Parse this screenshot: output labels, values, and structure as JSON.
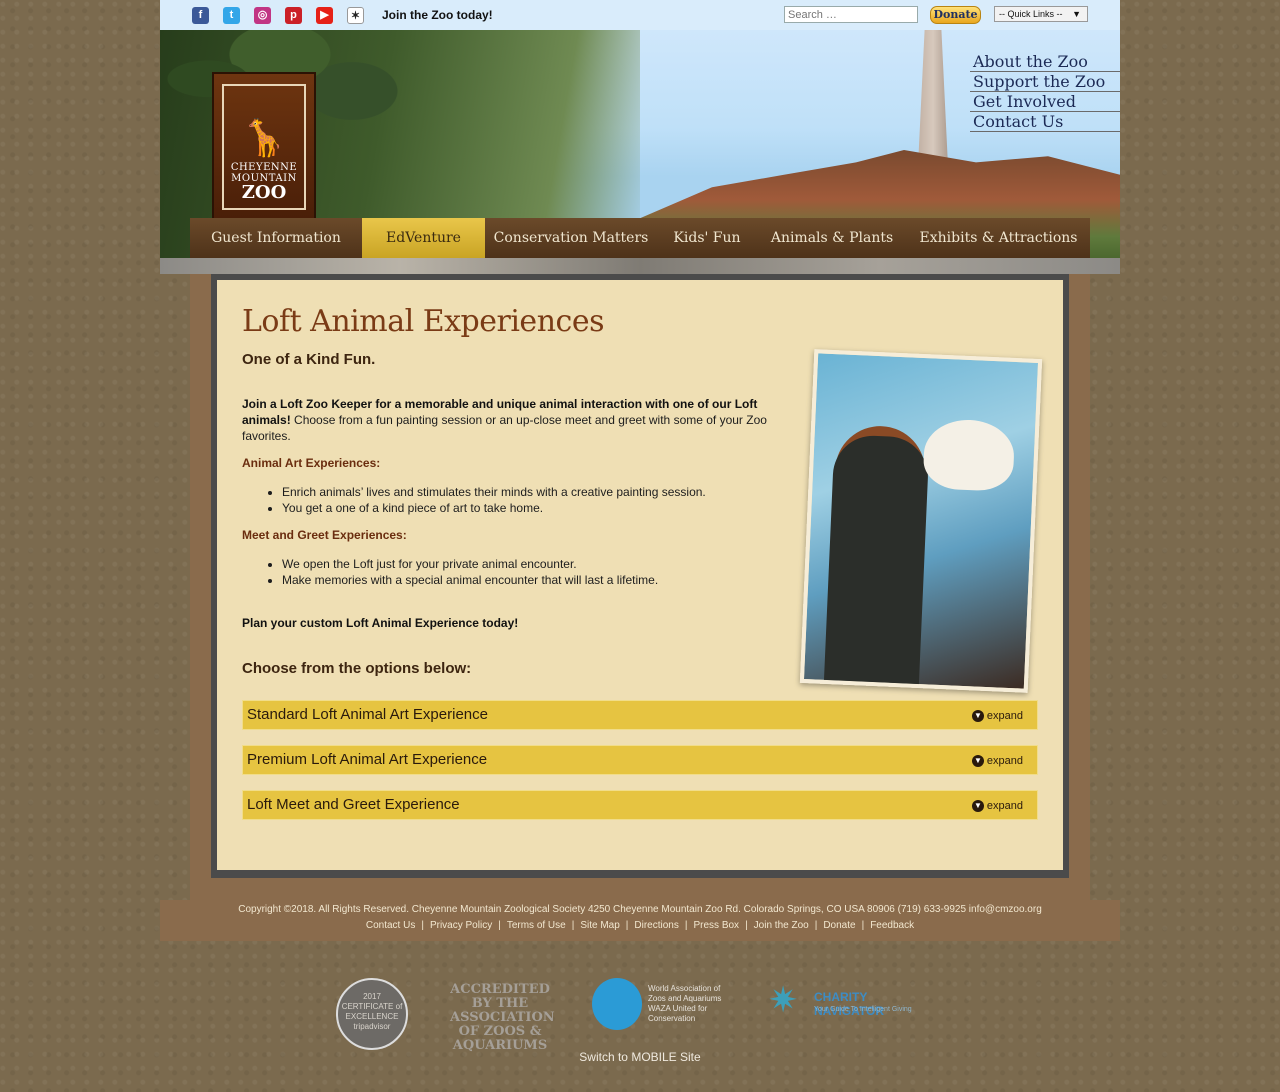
{
  "topbar": {
    "social": [
      {
        "icon": "facebook-icon",
        "glyph": "f",
        "color": "#3b5998"
      },
      {
        "icon": "twitter-icon",
        "glyph": "t",
        "color": "#33a6e8"
      },
      {
        "icon": "instagram-icon",
        "glyph": "◎",
        "color": "#c13584"
      },
      {
        "icon": "pinterest-icon",
        "glyph": "p",
        "color": "#cb2027"
      },
      {
        "icon": "youtube-icon",
        "glyph": "▶",
        "color": "#e62117"
      },
      {
        "icon": "giraffe-icon",
        "glyph": "✶",
        "color": "#ffffff"
      }
    ],
    "join_label": "Join the Zoo today!",
    "search_placeholder": "Search …",
    "donate_label": "Donate",
    "quick_links_label": "-- Quick Links --"
  },
  "banner": {
    "logo_line1": "CHEYENNE",
    "logo_line2": "MOUNTAIN",
    "logo_line3": "ZOO",
    "right_menu": [
      "About the Zoo",
      "Support the Zoo",
      "Get Involved",
      "Contact Us"
    ],
    "main_nav": [
      {
        "label": "Guest Information",
        "active": false
      },
      {
        "label": "EdVenture",
        "active": true
      },
      {
        "label": "Conservation Matters",
        "active": false
      },
      {
        "label": "Kids' Fun",
        "active": false
      },
      {
        "label": "Animals & Plants",
        "active": false
      },
      {
        "label": "Exhibits & Attractions",
        "active": false
      }
    ]
  },
  "content": {
    "title": "Loft Animal Experiences",
    "subtitle": "One of a Kind Fun.",
    "intro_bold": "Join a Loft Zoo Keeper for a memorable and unique animal interaction with one of our Loft animals!",
    "intro_rest": " Choose from a fun painting session or an up-close meet and greet with some of your Zoo favorites.",
    "art_heading": "Animal Art Experiences:",
    "art_items": [
      "Enrich animals’ lives and stimulates their minds with a creative painting session.",
      "You get a one of a kind piece of art to take home."
    ],
    "meet_heading": "Meet and Greet Experiences:",
    "meet_items": [
      "We open the Loft just for your private animal encounter.",
      "Make memories with a special animal encounter that will last a lifetime."
    ],
    "plan": "Plan your custom Loft Animal Experience today!",
    "choose": "Choose from the options below:",
    "options": [
      {
        "title": "Standard Loft Animal Art Experience",
        "action": "expand"
      },
      {
        "title": "Premium Loft Animal Art Experience",
        "action": "expand"
      },
      {
        "title": "Loft Meet and Greet Experience",
        "action": "expand"
      }
    ]
  },
  "footer": {
    "copyright": "Copyright ©2018. All Rights Reserved.  Cheyenne Mountain Zoological Society  4250 Cheyenne Mountain Zoo Rd.  Colorado Springs, CO USA  80906  (719) 633-9925  info@cmzoo.org",
    "links": [
      "Contact Us",
      "Privacy Policy",
      "Terms of Use",
      "Site Map",
      "Directions",
      "Press Box",
      "Join the Zoo",
      "Donate",
      "Feedback"
    ],
    "badges": {
      "tripadvisor": "2017 CERTIFICATE of EXCELLENCE tripadvisor",
      "aza": "ACCREDITED BY THE ASSOCIATION OF ZOOS & AQUARIUMS",
      "waza": "World Association of Zoos and Aquariums WAZA United for Conservation",
      "charity_name": "CHARITY NAVIGATOR",
      "charity_tag": "Your Guide To Intelligent Giving"
    },
    "mobile_link": "Switch to MOBILE Site"
  }
}
